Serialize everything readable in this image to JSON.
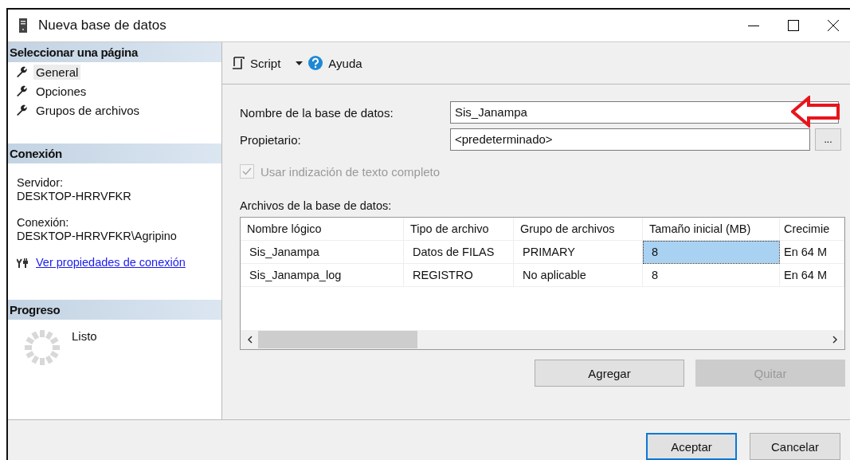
{
  "window": {
    "title": "Nueva base de datos"
  },
  "sidebar": {
    "pages_header": "Seleccionar una página",
    "pages": [
      {
        "label": "General",
        "selected": true
      },
      {
        "label": "Opciones",
        "selected": false
      },
      {
        "label": "Grupos de archivos",
        "selected": false
      }
    ],
    "connection_header": "Conexión",
    "server_label": "Servidor:",
    "server": "DESKTOP-HRRVFKR",
    "connection_label": "Conexión:",
    "connection": "DESKTOP-HRRVFKR\\Agripino",
    "connection_link": "Ver propiedades de conexión",
    "progress_header": "Progreso",
    "progress_status": "Listo"
  },
  "toolbar": {
    "script": "Script",
    "help": "Ayuda"
  },
  "form": {
    "name_label": "Nombre de la base de datos:",
    "name_value": "Sis_Janampa",
    "owner_label": "Propietario:",
    "owner_value": "<predeterminado>",
    "browse": "...",
    "fulltext": {
      "label": "Usar indización de texto completo",
      "checked": true,
      "disabled": true
    }
  },
  "files": {
    "label": "Archivos de la base de datos:",
    "columns": [
      "Nombre lógico",
      "Tipo de archivo",
      "Grupo de archivos",
      "Tamaño inicial (MB)",
      "Crecimie"
    ],
    "rows": [
      [
        {
          "text": "Sis_Janampa",
          "selected": false
        },
        {
          "text": "Datos de FILAS",
          "selected": false
        },
        {
          "text": "PRIMARY",
          "selected": false
        },
        {
          "text": "8",
          "selected": true
        },
        {
          "text": "En 64 M",
          "selected": false
        }
      ],
      [
        {
          "text": "Sis_Janampa_log",
          "selected": false
        },
        {
          "text": "REGISTRO",
          "selected": false
        },
        {
          "text": "No aplicable",
          "selected": false
        },
        {
          "text": "8",
          "selected": false
        },
        {
          "text": "En 64 M",
          "selected": false
        }
      ]
    ]
  },
  "file_buttons": [
    {
      "label": "Agregar",
      "disabled": false
    },
    {
      "label": "Quitar",
      "disabled": true
    }
  ],
  "dialog_buttons": [
    {
      "label": "Aceptar",
      "default": true
    },
    {
      "label": "Cancelar",
      "default": false
    }
  ]
}
